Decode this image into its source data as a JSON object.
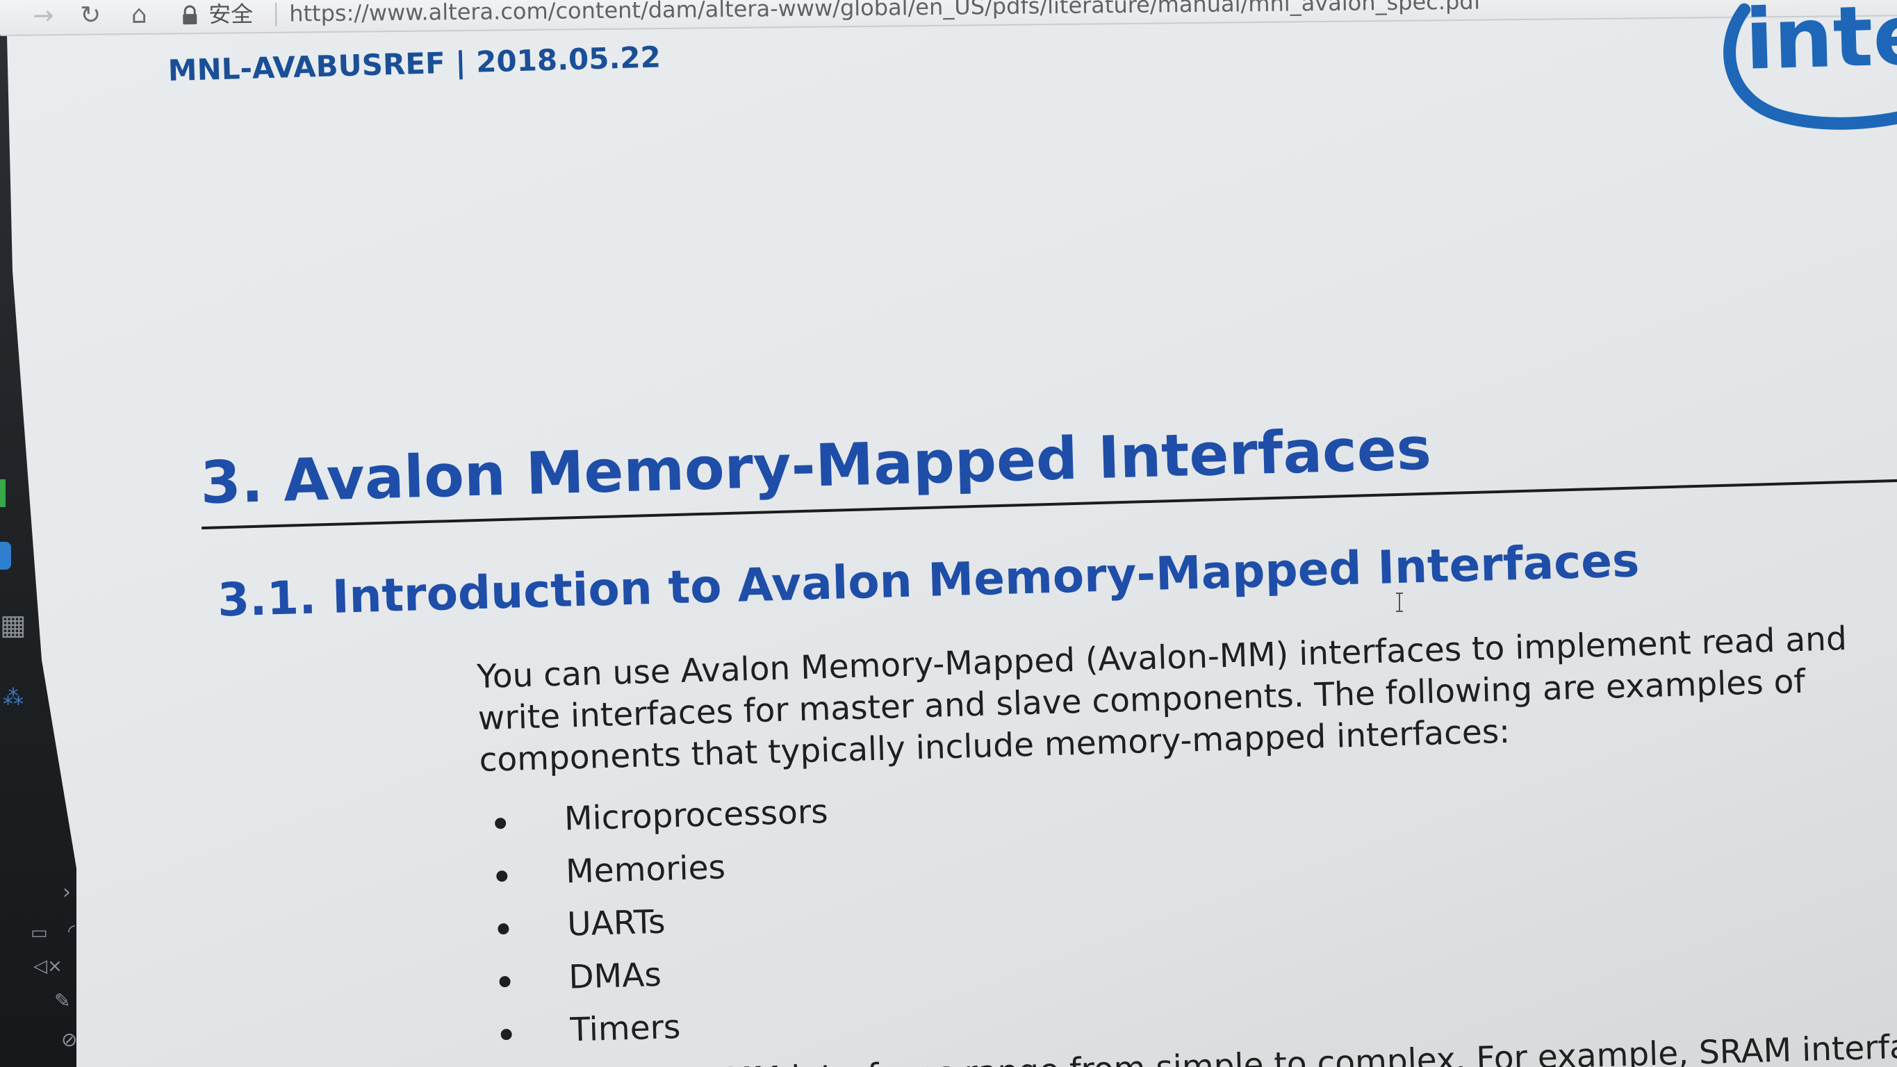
{
  "browser": {
    "secure_label": "安全",
    "url": "https://www.altera.com/content/dam/altera-www/global/en_US/pdfs/literature/manual/mnl_avalon_spec.pdf"
  },
  "document": {
    "header": "MNL-AVABUSREF | 2018.05.22",
    "logo_text": "inte",
    "heading_1": "3. Avalon Memory-Mapped Interfaces",
    "heading_2": "3.1. Introduction to Avalon Memory-Mapped Interfaces",
    "intro_lines": [
      "You can use Avalon Memory-Mapped (Avalon-MM) interfaces to implement read and",
      "write interfaces for master and slave components. The following are examples of",
      "components that typically include memory-mapped interfaces:"
    ],
    "bullets": [
      "Microprocessors",
      "Memories",
      "UARTs",
      "DMAs",
      "Timers"
    ],
    "partial_line": "MM interfaces range from simple to complex. For example, SRAM interfaces"
  },
  "colors": {
    "heading_blue": "#1e4ea8",
    "header_blue": "#1a4f97",
    "logo_blue": "#1e67b8",
    "body_text": "#1f1f1f"
  },
  "icons": {
    "forward": "arrow-right-icon",
    "reload": "reload-icon",
    "home": "home-icon",
    "lock": "lock-icon",
    "cursor": "ibeam-cursor-icon"
  }
}
